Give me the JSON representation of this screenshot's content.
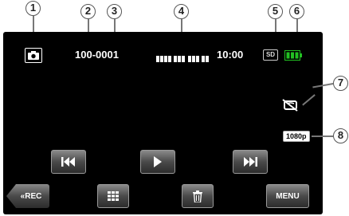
{
  "callouts": [
    "1",
    "2",
    "3",
    "4",
    "5",
    "6",
    "7",
    "8"
  ],
  "status": {
    "folder_number": "100",
    "separator": "-",
    "file_number": "0001",
    "time": "10:00",
    "media": "SD",
    "hd_format": "1080p"
  },
  "buttons": {
    "rec_label": "REC",
    "rec_prefix": "«",
    "menu_label": "MENU"
  },
  "icons": {
    "mode": "camera-icon",
    "battery": "battery-icon",
    "sd": "sd-card-icon",
    "no_wifi": "wifi-off-icon"
  },
  "colors": {
    "screen": "#000000",
    "battery": "#22c022",
    "callout_border": "#555555"
  }
}
